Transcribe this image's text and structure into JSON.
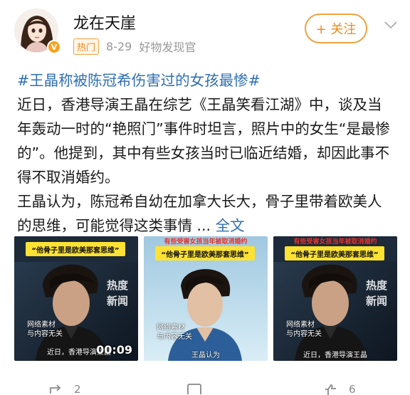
{
  "header": {
    "username": "龙在天崖",
    "hot_tag": "热门",
    "date": "8-29",
    "source": "好物发现官",
    "follow_label": "+ 关注"
  },
  "post": {
    "topic": "#王晶称被陈冠希伤害过的女孩最惨#",
    "paragraph1": "近日，香港导演王晶在综艺《王晶笑看江湖》中，谈及当年轰动一时的“艳照门”事件时坦言，照片中的女生“是最惨的”。他提到，其中有些女孩当时已临近结婚，却因此事不得不取消婚约。",
    "paragraph2": "王晶认为，陈冠希自幼在加拿大长大，骨子里带着欧美人的思维，可能觉得这类事情 ... ",
    "full_text_link": "全文"
  },
  "thumbnails": [
    {
      "banner": "“他骨子里是欧美那套思维”",
      "hot_stamp": "热度\n新闻",
      "source_stamp": "网络素材\n与内容无关",
      "caption": "近日，香港导演王晶",
      "duration": "00:09"
    },
    {
      "banner_top": "有些受害女孩当年被取消婚约",
      "banner": "“他骨子里是欧美那套思维”",
      "source_stamp": "网络素材\n与内容无关",
      "caption": "王晶认为"
    },
    {
      "banner_top": "有些受害女孩当年被取消婚约",
      "banner": "“他骨子里是欧美那套思维”",
      "hot_stamp": "热度\n新闻",
      "source_stamp": "网络素材\n与内容无关",
      "caption": "近日，香港导演王晶"
    }
  ],
  "footer": {
    "repost_count": "2",
    "comment_count": "",
    "like_count": "6"
  },
  "colors": {
    "accent_orange": "#f0a240",
    "link_blue": "#2f6fb3",
    "banner_yellow": "#fde233"
  }
}
